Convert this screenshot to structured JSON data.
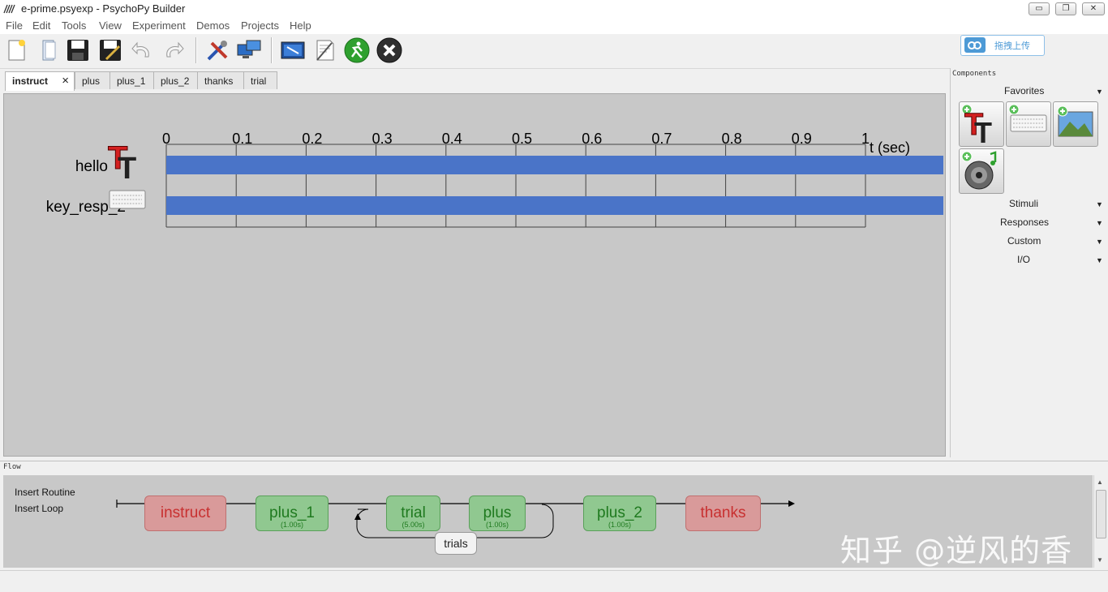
{
  "window": {
    "title": "e-prime.psyexp - PsychoPy Builder",
    "minimize_glyph": "▭",
    "restore_glyph": "❐",
    "close_glyph": "✕"
  },
  "menu": [
    "File",
    "Edit",
    "Tools",
    "View",
    "Experiment",
    "Demos",
    "Projects",
    "Help"
  ],
  "toolbar": {
    "icons": [
      "new-file-icon",
      "open-file-icon",
      "save-icon",
      "save-as-icon",
      "undo-icon",
      "redo-icon",
      "preferences-icon",
      "monitor-center-icon",
      "experiment-settings-icon",
      "compile-script-icon",
      "run-icon",
      "stop-icon"
    ],
    "upload_label": "拖拽上传",
    "accent_colors": {
      "run": "#2ea02e",
      "stop": "#303030",
      "upload": "#4d9ad6"
    }
  },
  "routine_tabs": [
    {
      "label": "instruct",
      "active": true,
      "close": "×"
    },
    {
      "label": "plus"
    },
    {
      "label": "plus_1"
    },
    {
      "label": "plus_2"
    },
    {
      "label": "thanks"
    },
    {
      "label": "trial"
    }
  ],
  "timeline": {
    "ticks": [
      "0",
      "0.1",
      "0.2",
      "0.3",
      "0.4",
      "0.5",
      "0.6",
      "0.7",
      "0.8",
      "0.9",
      "1"
    ],
    "axis_label": "t (sec)",
    "bar_color": "#4a74c8",
    "components": [
      {
        "name": "hello",
        "icon": "text-component-icon"
      },
      {
        "name": "key_resp_2",
        "icon": "keyboard-component-icon"
      }
    ]
  },
  "components_panel": {
    "header": "Components",
    "favorites_label": "Favorites",
    "favorites": [
      "text-component-icon",
      "keyboard-component-icon",
      "image-component-icon",
      "sound-component-icon"
    ],
    "categories": [
      "Stimuli",
      "Responses",
      "Custom",
      "I/O"
    ],
    "arrow": "▼"
  },
  "flow": {
    "label": "Flow",
    "commands": [
      "Insert Routine",
      "Insert Loop"
    ],
    "routines": [
      {
        "name": "instruct",
        "duration": "",
        "color": "red"
      },
      {
        "name": "plus_1",
        "duration": "(1.00s)",
        "color": "green"
      },
      {
        "name": "trial",
        "duration": "(5.00s)",
        "color": "green"
      },
      {
        "name": "plus",
        "duration": "(1.00s)",
        "color": "green"
      },
      {
        "name": "plus_2",
        "duration": "(1.00s)",
        "color": "green"
      },
      {
        "name": "thanks",
        "duration": "",
        "color": "red"
      }
    ],
    "loop_name": "trials"
  },
  "watermark": "知乎 @逆风的香"
}
